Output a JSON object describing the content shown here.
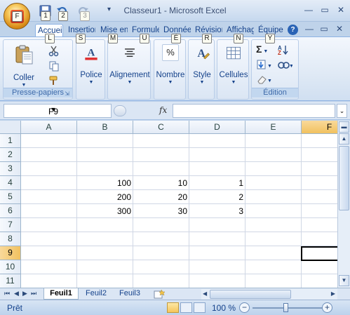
{
  "window": {
    "title": "Classeur1 - Microsoft Excel",
    "office_button_key": "F",
    "controls": {
      "minimize": "—",
      "restore": "▭",
      "close": "✕"
    },
    "ribbon_controls": {
      "help": "?",
      "minimize": "—",
      "restore": "▭",
      "close": "✕"
    }
  },
  "quick_access": {
    "keytips": [
      "1",
      "2",
      "3"
    ],
    "menu_arrow": "▾"
  },
  "ribbon": {
    "tabs": [
      {
        "label": "Accueil",
        "keytip": "L",
        "active": true
      },
      {
        "label": "Insertion",
        "keytip": "S"
      },
      {
        "label": "Mise en page",
        "keytip": "M"
      },
      {
        "label": "Formules",
        "keytip": "U"
      },
      {
        "label": "Données",
        "keytip": "É"
      },
      {
        "label": "Révision",
        "keytip": "R"
      },
      {
        "label": "Affichage",
        "keytip": "N"
      },
      {
        "label": "Équipe",
        "keytip": "Y"
      }
    ],
    "groups": {
      "clipboard": {
        "label": "Presse-papiers",
        "paste_label": "Coller"
      },
      "font": {
        "label": "Police"
      },
      "alignment": {
        "label": "Alignement"
      },
      "number": {
        "label": "Nombre",
        "icon_text": "%"
      },
      "style": {
        "label": "Style"
      },
      "cells": {
        "label": "Cellules"
      },
      "editing": {
        "label": "Édition",
        "sum_icon": "Σ"
      }
    }
  },
  "formula_bar": {
    "name_box": "F9",
    "fx_label": "fx",
    "formula": ""
  },
  "grid": {
    "columns": [
      "A",
      "B",
      "C",
      "D",
      "E",
      "F"
    ],
    "selected_column": "F",
    "rows": [
      "1",
      "2",
      "3",
      "4",
      "5",
      "6",
      "7",
      "8",
      "9",
      "10",
      "11"
    ],
    "selected_row": "9",
    "cells": {
      "B4": "100",
      "C4": "10",
      "D4": "1",
      "B5": "200",
      "C5": "20",
      "D5": "2",
      "B6": "300",
      "C6": "30",
      "D6": "3"
    }
  },
  "sheets": {
    "tabs": [
      "Feuil1",
      "Feuil2",
      "Feuil3"
    ],
    "active": "Feuil1"
  },
  "status": {
    "text": "Prêt",
    "zoom": "100 %",
    "zoom_minus": "−",
    "zoom_plus": "+"
  }
}
